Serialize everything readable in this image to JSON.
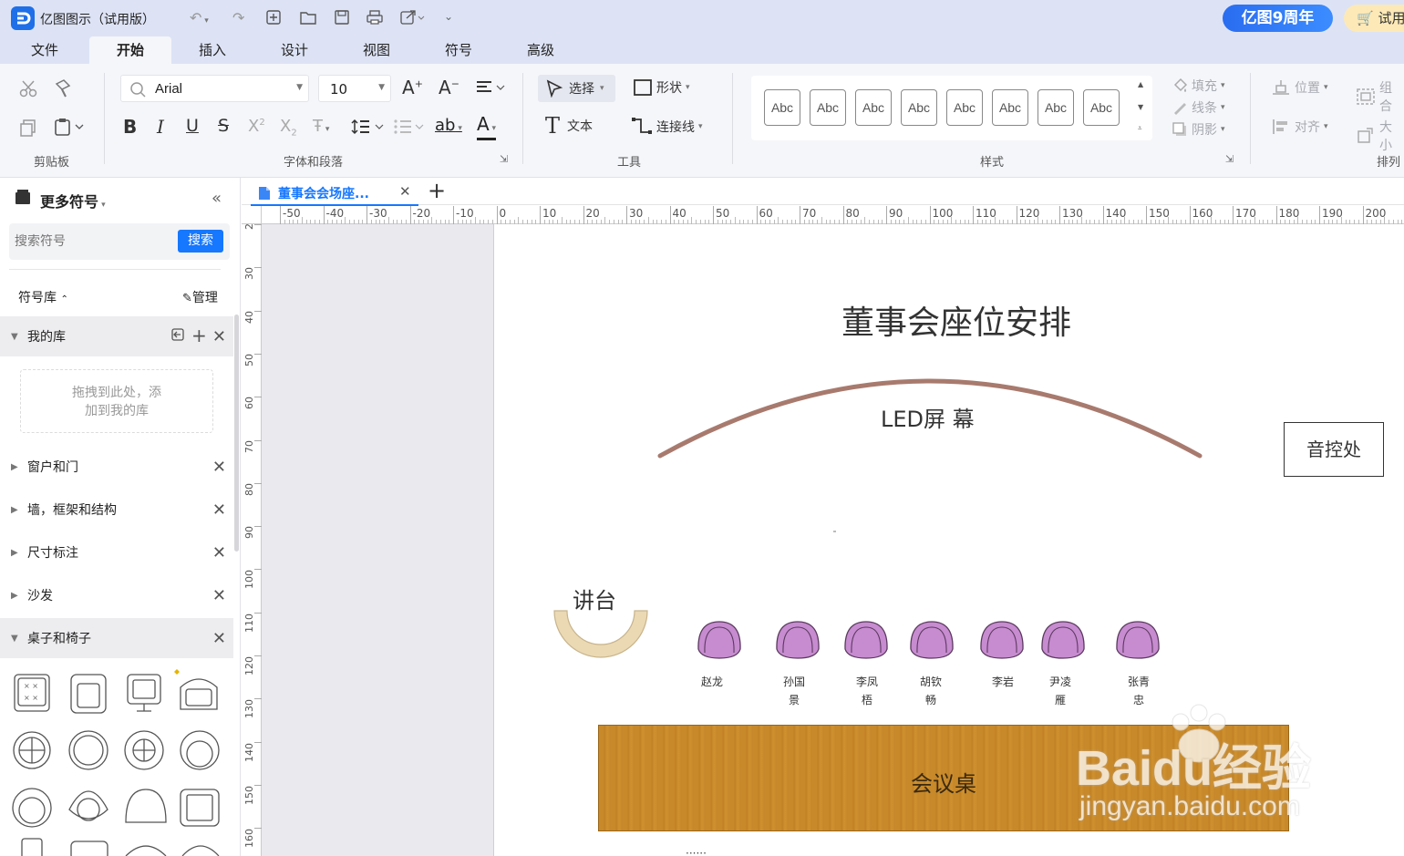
{
  "app": {
    "title": "亿图图示（试用版）",
    "anniversary_badge": "亿图9周年",
    "trial_button": "试用"
  },
  "menu_tabs": [
    "文件",
    "开始",
    "插入",
    "设计",
    "视图",
    "符号",
    "高级"
  ],
  "ribbon": {
    "font_name": "Arial",
    "font_size": "10",
    "select_label": "选择",
    "shape_label": "形状",
    "text_label": "文本",
    "connector_label": "连接线",
    "style_samples": [
      "Abc",
      "Abc",
      "Abc",
      "Abc",
      "Abc",
      "Abc",
      "Abc",
      "Abc"
    ],
    "fill_label": "填充",
    "line_label": "线条",
    "shadow_label": "阴影",
    "position_label": "位置",
    "align_label": "对齐",
    "group_label": "组合",
    "size_label": "大小",
    "groups": {
      "clipboard": "剪贴板",
      "font_paragraph": "字体和段落",
      "tools": "工具",
      "style": "样式",
      "arrange": "排列"
    }
  },
  "sidebar": {
    "title": "更多符号",
    "search_placeholder": "搜索符号",
    "search_button": "搜索",
    "library_label": "符号库",
    "manage_label": "管理",
    "my_library": "我的库",
    "drop_hint_line1": "拖拽到此处，添",
    "drop_hint_line2": "加到我的库",
    "libraries": [
      "窗户和门",
      "墙，框架和结构",
      "尺寸标注",
      "沙发"
    ],
    "open_library": "桌子和椅子"
  },
  "document": {
    "tab_title": "董事会会场座...",
    "ruler_x_labels": [
      "-50",
      "-40",
      "-30",
      "-20",
      "-10",
      "0",
      "10",
      "20",
      "30",
      "40",
      "50",
      "60",
      "70",
      "80",
      "90",
      "100",
      "110",
      "120",
      "130",
      "140",
      "150",
      "160",
      "170",
      "180",
      "190",
      "200"
    ],
    "ruler_y_labels": [
      "2",
      "30",
      "40",
      "50",
      "60",
      "70",
      "80",
      "90",
      "100",
      "110",
      "120",
      "130",
      "140",
      "150",
      "160"
    ]
  },
  "diagram": {
    "title": "董事会座位安排",
    "screen_label": "LED屏 幕",
    "sound_control": "音控处",
    "podium": "讲台",
    "table_label": "会议桌",
    "seats": [
      {
        "name_line1": "赵龙",
        "name_line2": ""
      },
      {
        "name_line1": "孙国",
        "name_line2": "景"
      },
      {
        "name_line1": "李凤",
        "name_line2": "梧"
      },
      {
        "name_line1": "胡钦",
        "name_line2": "畅"
      },
      {
        "name_line1": "李岩",
        "name_line2": ""
      },
      {
        "name_line1": "尹凌",
        "name_line2": "雁"
      },
      {
        "name_line1": "张青",
        "name_line2": "忠"
      }
    ],
    "chair_color": "#c78bd0",
    "table_color": "#c8892a",
    "arc_color": "#a87a6e"
  },
  "watermark": {
    "brand": "Baidu经验",
    "url": "jingyan.baidu.com"
  },
  "colors": {
    "accent": "#1677ff",
    "titlebar_bg": "#dde3f5"
  }
}
